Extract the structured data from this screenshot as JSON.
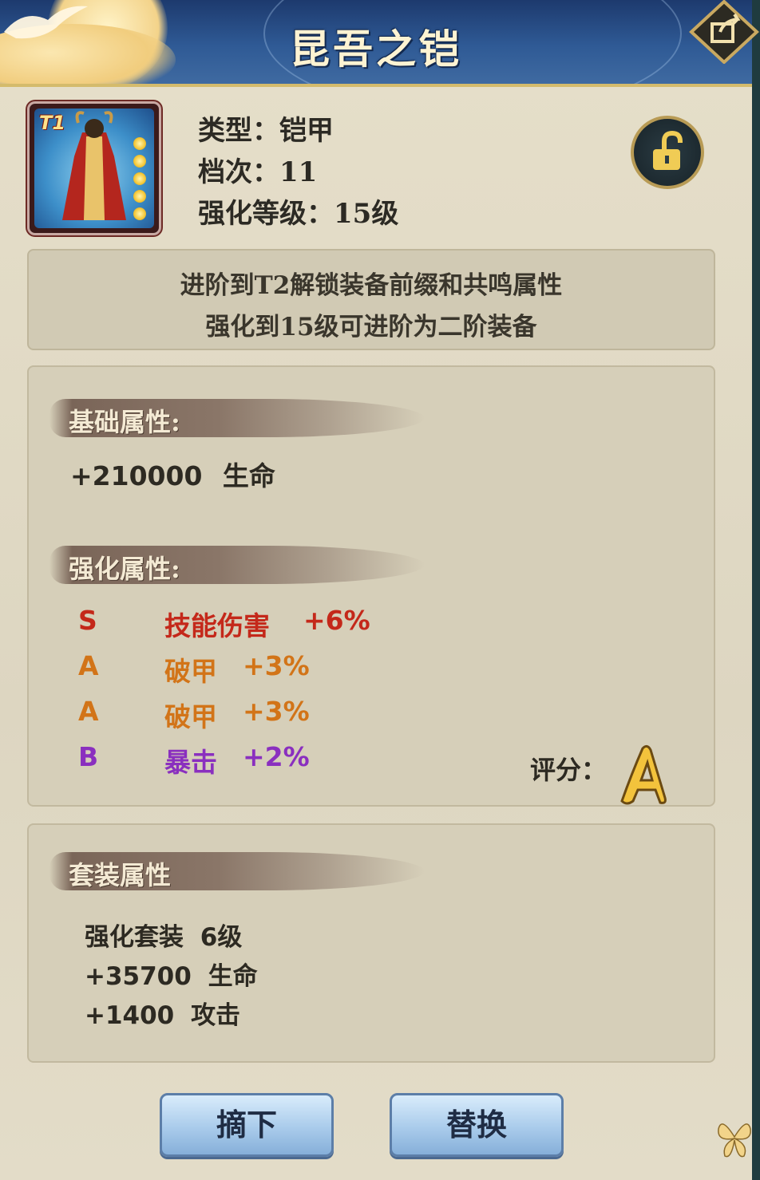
{
  "title": "昆吾之铠",
  "item": {
    "tier_badge": "T1",
    "type_line": "类型：铠甲",
    "grade_line": "档次：11",
    "level_line": "强化等级：15级"
  },
  "notice": {
    "line1": "进阶到T2解锁装备前缀和共鸣属性",
    "line2": "强化到15级可进阶为二阶装备"
  },
  "base_attr": {
    "heading": "基础属性:",
    "value": "+210000",
    "stat": "生命"
  },
  "enh_attr": {
    "heading": "强化属性:",
    "rows": [
      {
        "grade": "S",
        "name": "技能伤害",
        "value": "+6%",
        "color": "#c4281a"
      },
      {
        "grade": "A",
        "name": "破甲",
        "value": "+3%",
        "color": "#d27418"
      },
      {
        "grade": "A",
        "name": "破甲",
        "value": "+3%",
        "color": "#d27418"
      },
      {
        "grade": "B",
        "name": "暴击",
        "value": "+2%",
        "color": "#8a2fbf"
      }
    ],
    "score_label": "评分：",
    "score_grade": "A"
  },
  "set_attr": {
    "heading": "套装属性",
    "line1_name": "强化套装",
    "line1_level": "6级",
    "line2_value": "+35700",
    "line2_stat": "生命",
    "line3_value": "+1400",
    "line3_stat": "攻击"
  },
  "buttons": {
    "unequip": "摘下",
    "replace": "替换"
  },
  "icons": [
    "share-icon",
    "lock-icon",
    "crane-icon",
    "butterfly-icon"
  ]
}
